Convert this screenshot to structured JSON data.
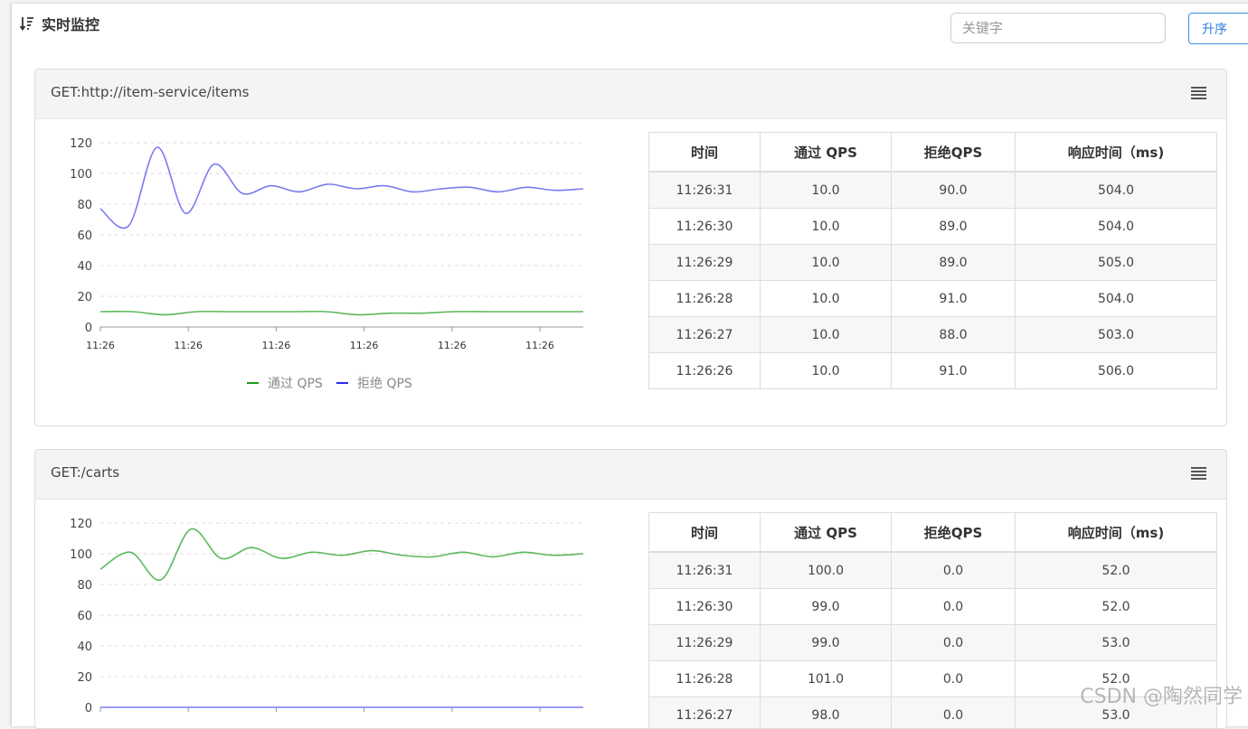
{
  "header": {
    "title": "实时监控",
    "search_placeholder": "关键字",
    "sort_label": "升序"
  },
  "colors": {
    "pass": "#5cb85c",
    "reject": "#7b7bf0",
    "accent": "#2b7fe0",
    "legend_pass": "#1a9a1a",
    "legend_reject": "#2a2aee"
  },
  "table_headers": [
    "时间",
    "通过 QPS",
    "拒绝QPS",
    "响应时间（ms)"
  ],
  "panels": [
    {
      "title": "GET:http://item-service/items",
      "menu_icon": "list-icon",
      "chart_data": {
        "type": "line",
        "ylim": [
          0,
          120
        ],
        "y_ticks": [
          0,
          20,
          40,
          60,
          80,
          100,
          120
        ],
        "x_tick_labels": [
          "11:26",
          "11:26",
          "11:26",
          "11:26",
          "11:26",
          "11:26"
        ],
        "grid": true,
        "legend_position": "bottom",
        "series": [
          {
            "name": "通过 QPS",
            "color": "#5cb85c",
            "values": [
              10,
              10,
              8,
              10,
              10,
              10,
              10,
              10,
              8,
              9,
              9,
              10,
              10,
              10,
              10,
              10
            ]
          },
          {
            "name": "拒绝 QPS",
            "color": "#7b7bf0",
            "values": [
              77,
              66,
              117,
              74,
              106,
              87,
              92,
              88,
              93,
              90,
              92,
              88,
              90,
              91,
              88,
              91,
              89,
              90
            ]
          }
        ]
      },
      "rows": [
        [
          "11:26:31",
          "10.0",
          "90.0",
          "504.0"
        ],
        [
          "11:26:30",
          "10.0",
          "89.0",
          "504.0"
        ],
        [
          "11:26:29",
          "10.0",
          "89.0",
          "505.0"
        ],
        [
          "11:26:28",
          "10.0",
          "91.0",
          "504.0"
        ],
        [
          "11:26:27",
          "10.0",
          "88.0",
          "503.0"
        ],
        [
          "11:26:26",
          "10.0",
          "91.0",
          "506.0"
        ]
      ]
    },
    {
      "title": "GET:/carts",
      "menu_icon": "list-icon",
      "chart_data": {
        "type": "line",
        "ylim": [
          0,
          120
        ],
        "y_ticks": [
          0,
          20,
          40,
          60,
          80,
          100,
          120
        ],
        "grid": true,
        "series": [
          {
            "name": "通过 QPS",
            "color": "#5cb85c",
            "values": [
              90,
              101,
              83,
              116,
              97,
              104,
              97,
              101,
              99,
              102,
              99,
              98,
              101,
              98,
              101,
              99,
              100
            ]
          },
          {
            "name": "拒绝 QPS",
            "color": "#7b7bf0",
            "values": [
              0,
              0,
              0,
              0,
              0,
              0,
              0,
              0,
              0,
              0,
              0,
              0,
              0,
              0,
              0,
              0,
              0
            ]
          }
        ]
      },
      "rows": [
        [
          "11:26:31",
          "100.0",
          "0.0",
          "52.0"
        ],
        [
          "11:26:30",
          "99.0",
          "0.0",
          "52.0"
        ],
        [
          "11:26:29",
          "99.0",
          "0.0",
          "53.0"
        ],
        [
          "11:26:28",
          "101.0",
          "0.0",
          "52.0"
        ],
        [
          "11:26:27",
          "98.0",
          "0.0",
          "53.0"
        ]
      ]
    }
  ],
  "watermark": "CSDN @陶然同学"
}
